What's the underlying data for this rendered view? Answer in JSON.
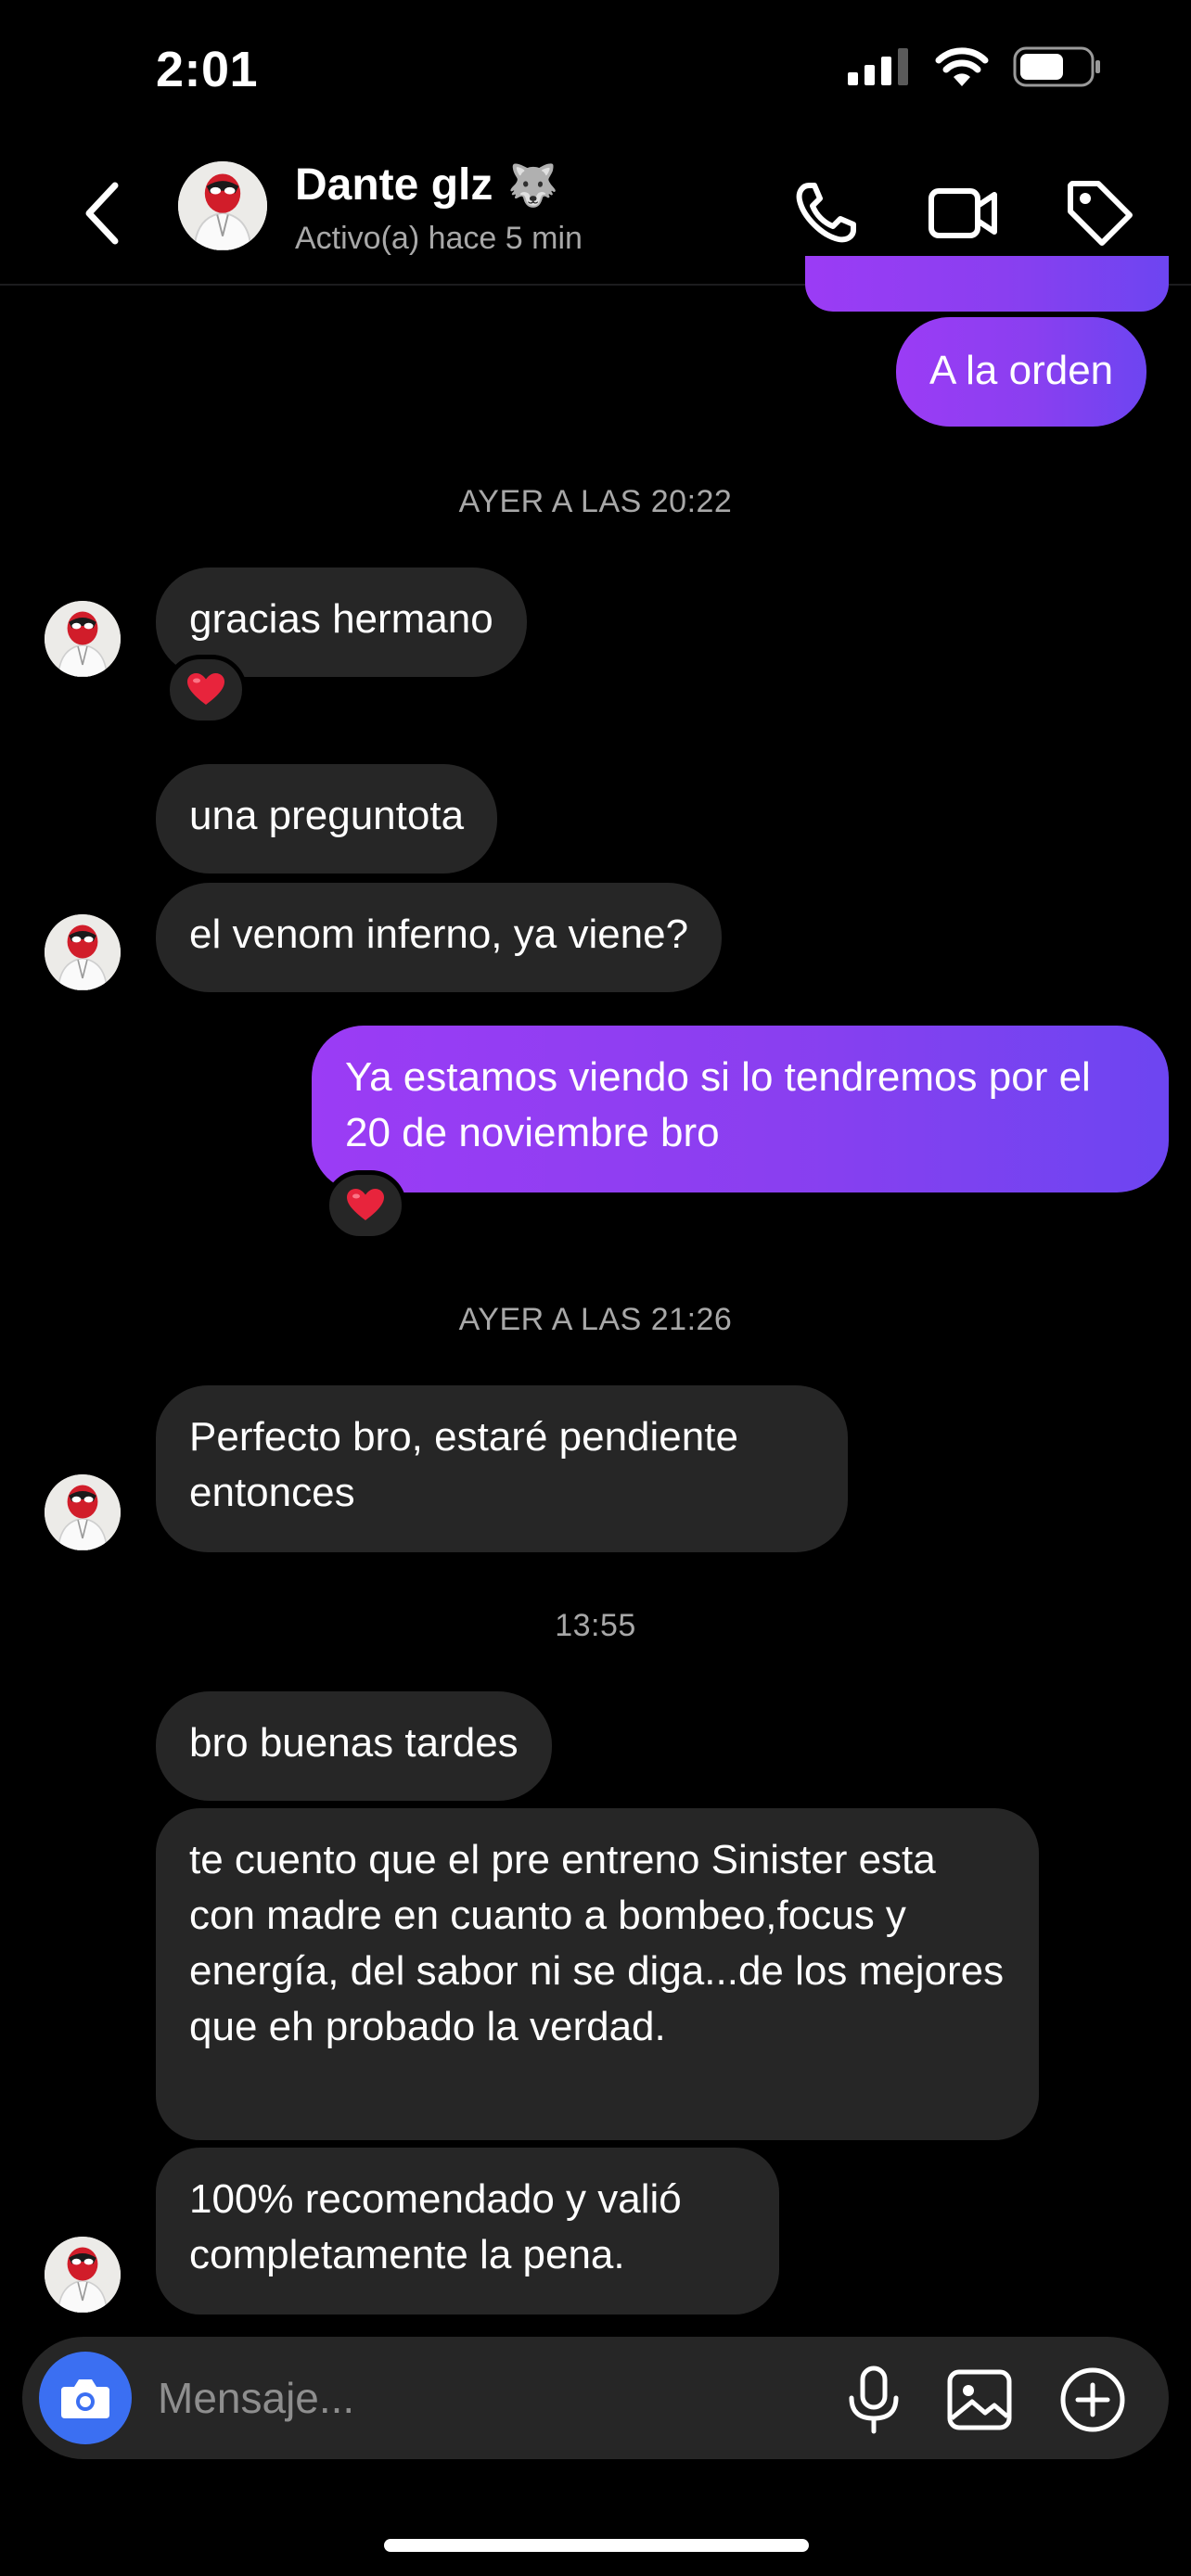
{
  "status_bar": {
    "time": "2:01"
  },
  "header": {
    "contact_name": "Dante glz",
    "contact_emoji": "🐺",
    "activity_status": "Activo(a) hace 5 min"
  },
  "messages": {
    "m1": "A la orden",
    "ts1": "AYER A LAS 20:22",
    "m2": "gracias hermano",
    "m3": "una preguntota",
    "m4": "el venom inferno, ya viene?",
    "m5": "Ya estamos viendo si lo tendremos por el 20 de noviembre bro",
    "ts2": "AYER A LAS 21:26",
    "m6": "Perfecto bro, estaré pendiente entonces",
    "ts3": "13:55",
    "m7": "bro buenas tardes",
    "m8": "te cuento que el pre entreno Sinister esta con madre en cuanto a bombeo,focus y energía, del sabor ni se diga...de los mejores que eh probado la verdad.",
    "m9": "100% recomendado y valió completamente la pena.",
    "reaction": "❤️"
  },
  "composer": {
    "placeholder": "Mensaje..."
  },
  "colors": {
    "outgoing_start": "#9b3cf5",
    "outgoing_end": "#6d45f1",
    "incoming": "#262626",
    "camera": "#3b6ff2",
    "reaction_heart": "#e8243c"
  },
  "icons": [
    "back-icon",
    "phone-icon",
    "video-camera-icon",
    "tag-icon",
    "camera-icon",
    "microphone-icon",
    "gallery-icon",
    "plus-circle-icon",
    "signal-icon",
    "wifi-icon",
    "battery-icon"
  ]
}
